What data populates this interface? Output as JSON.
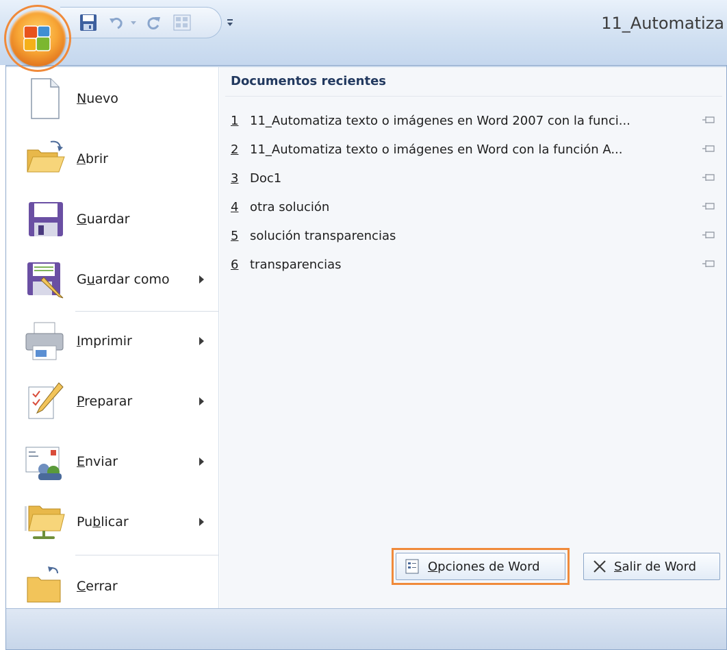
{
  "window": {
    "title": "11_Automatiza"
  },
  "qat": {
    "buttons": [
      "save-icon",
      "undo-icon",
      "redo-icon",
      "table-icon",
      "customize-dropdown-icon"
    ]
  },
  "menu": {
    "items": [
      {
        "label": "Nuevo",
        "underline_char": "N",
        "has_submenu": false,
        "icon": "new-document-icon"
      },
      {
        "label": "Abrir",
        "underline_char": "A",
        "has_submenu": false,
        "icon": "open-folder-icon"
      },
      {
        "label": "Guardar",
        "underline_char": "G",
        "has_submenu": false,
        "icon": "save-icon"
      },
      {
        "label": "Guardar como",
        "underline_char": "u",
        "has_submenu": true,
        "icon": "save-as-icon"
      },
      {
        "label": "Imprimir",
        "underline_char": "I",
        "has_submenu": true,
        "icon": "printer-icon"
      },
      {
        "label": "Preparar",
        "underline_char": "P",
        "has_submenu": true,
        "icon": "prepare-pencil-icon"
      },
      {
        "label": "Enviar",
        "underline_char": "E",
        "has_submenu": true,
        "icon": "send-icon"
      },
      {
        "label": "Publicar",
        "underline_char": "b",
        "has_submenu": true,
        "icon": "publish-folder-icon"
      },
      {
        "label": "Cerrar",
        "underline_char": "C",
        "has_submenu": false,
        "icon": "close-folder-icon"
      }
    ]
  },
  "recent": {
    "title": "Documentos recientes",
    "items": [
      {
        "num": "1",
        "name": "11_Automatiza texto o imágenes en Word 2007 con la funci..."
      },
      {
        "num": "2",
        "name": "11_Automatiza texto o imágenes en Word con la función A..."
      },
      {
        "num": "3",
        "name": "Doc1"
      },
      {
        "num": "4",
        "name": "otra solución"
      },
      {
        "num": "5",
        "name": "solución transparencias"
      },
      {
        "num": "6",
        "name": "transparencias"
      }
    ]
  },
  "footer": {
    "options_label": "Opciones de Word",
    "exit_label": "Salir de Word"
  },
  "colors": {
    "highlight": "#f08a3a",
    "recent_title": "#22395f"
  }
}
